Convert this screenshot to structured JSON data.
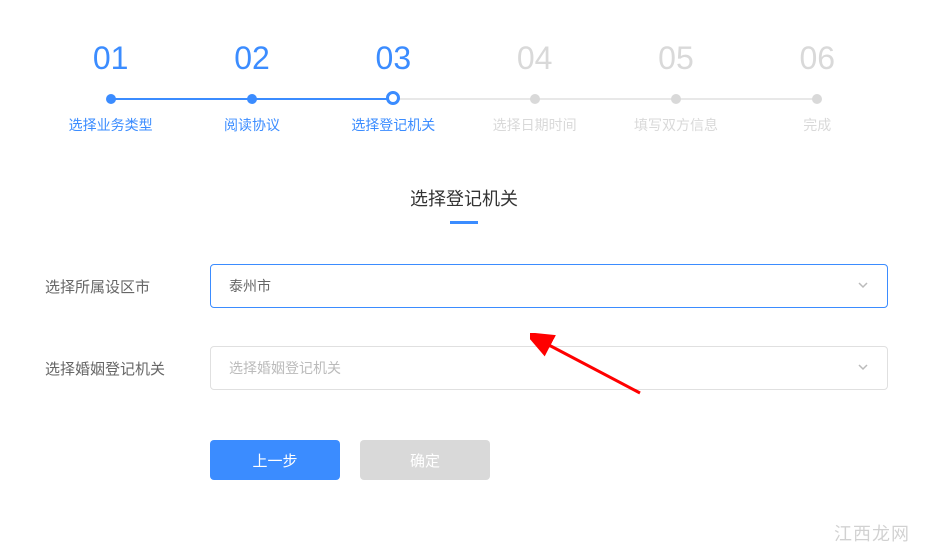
{
  "steps": [
    {
      "number": "01",
      "label": "选择业务类型",
      "state": "completed"
    },
    {
      "number": "02",
      "label": "阅读协议",
      "state": "completed"
    },
    {
      "number": "03",
      "label": "选择登记机关",
      "state": "current"
    },
    {
      "number": "04",
      "label": "选择日期时间",
      "state": "pending"
    },
    {
      "number": "05",
      "label": "填写双方信息",
      "state": "pending"
    },
    {
      "number": "06",
      "label": "完成",
      "state": "pending"
    }
  ],
  "section_title": "选择登记机关",
  "form": {
    "city_label": "选择所属设区市",
    "city_value": "泰州市",
    "agency_label": "选择婚姻登记机关",
    "agency_placeholder": "选择婚姻登记机关"
  },
  "buttons": {
    "prev": "上一步",
    "confirm": "确定"
  },
  "watermark": "江西龙网"
}
